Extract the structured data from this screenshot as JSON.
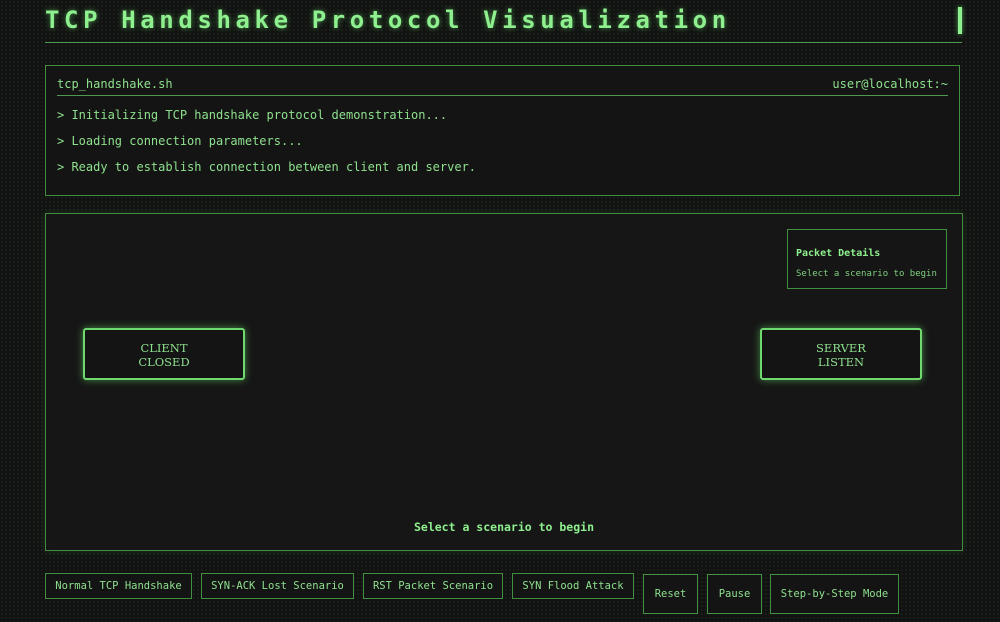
{
  "header": {
    "title": "TCP Handshake Protocol Visualization"
  },
  "terminal": {
    "filename": "tcp_handshake.sh",
    "user": "user@localhost:~",
    "lines": [
      "> Initializing TCP handshake protocol demonstration...",
      "> Loading connection parameters...",
      "> Ready to establish connection between client and server."
    ]
  },
  "stage": {
    "packet_details": {
      "title": "Packet Details",
      "text": "Select a scenario to begin"
    },
    "client": {
      "label": "CLIENT",
      "state": "CLOSED"
    },
    "server": {
      "label": "SERVER",
      "state": "LISTEN"
    },
    "status": "Select a scenario to begin"
  },
  "controls": {
    "normal": "Normal TCP Handshake",
    "synack_lost": "SYN-ACK Lost Scenario",
    "rst": "RST Packet Scenario",
    "syn_flood": "SYN Flood Attack",
    "reset": "Reset",
    "pause": "Pause",
    "step": "Step-by-Step Mode"
  },
  "colors": {
    "background": "#121212",
    "accent": "#8ef08e",
    "border": "#3f8f3f"
  }
}
